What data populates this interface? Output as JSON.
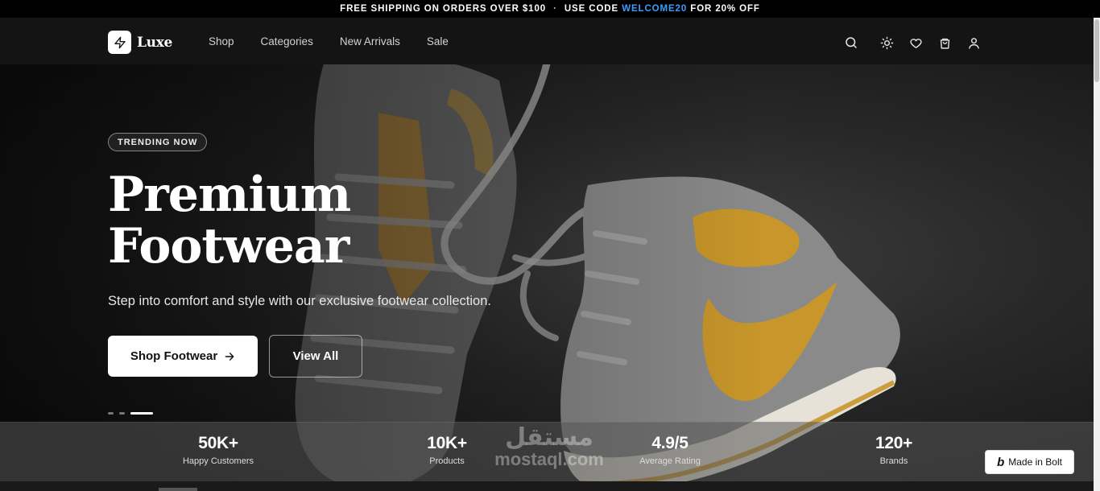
{
  "announcement": {
    "part1": "FREE SHIPPING ON ORDERS OVER $100",
    "separator": "·",
    "part2": "USE CODE",
    "code": "WELCOME20",
    "part3": "FOR 20% OFF"
  },
  "header": {
    "brand": "Luxe",
    "nav": [
      "Shop",
      "Categories",
      "New Arrivals",
      "Sale"
    ],
    "icons": [
      "search-icon",
      "sun-icon",
      "heart-icon",
      "shopping-bag-icon",
      "user-icon"
    ]
  },
  "hero": {
    "badge": "TRENDING NOW",
    "title_line1": "Premium",
    "title_line2": "Footwear",
    "subtitle": "Step into comfort and style with our exclusive footwear collection.",
    "primary_button": "Shop Footwear",
    "secondary_button": "View All",
    "slides": 3,
    "active_slide": 3
  },
  "stats": [
    {
      "value": "50K+",
      "label": "Happy Customers"
    },
    {
      "value": "10K+",
      "label": "Products"
    },
    {
      "value": "4.9/5",
      "label": "Average Rating"
    },
    {
      "value": "120+",
      "label": "Brands"
    }
  ],
  "watermark": {
    "arabic": "مستقل",
    "latin": "mostaql.com"
  },
  "bolt_badge": {
    "label": "Made in Bolt"
  },
  "colors": {
    "accent_code": "#3b9dff",
    "shoe_accent": "#c8962a",
    "background": "#141414"
  }
}
